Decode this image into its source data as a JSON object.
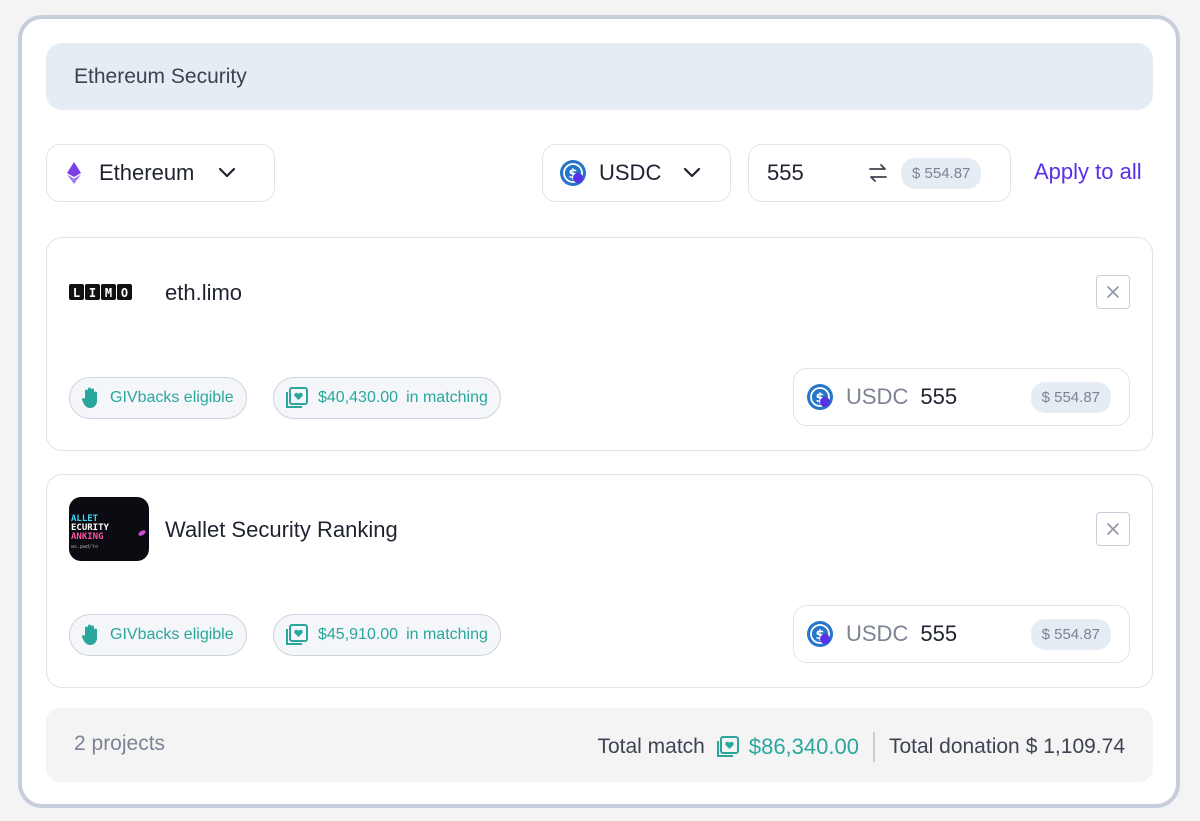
{
  "category": {
    "title": "Ethereum Security"
  },
  "network_selector": {
    "label": "Ethereum",
    "icon": "ethereum-icon"
  },
  "token_selector": {
    "label": "USDC",
    "icon": "usdc-icon"
  },
  "global_amount": {
    "value": "555",
    "usd": "$ 554.87"
  },
  "apply_all_label": "Apply to all",
  "colors": {
    "accent": "#5b2ee8",
    "teal": "#2aa79d",
    "chip_bg": "#e5ecf3"
  },
  "projects": [
    {
      "name": "eth.limo",
      "logo_text": "LIMO",
      "givbacks_label": "GIVbacks eligible",
      "matching_amount": "$40,430.00",
      "matching_suffix": "in matching",
      "token": "USDC",
      "amount": "555",
      "usd": "$ 554.87"
    },
    {
      "name": "Wallet Security Ranking",
      "logo_text": "WALLET SECURITY RANKING",
      "givbacks_label": "GIVbacks eligible",
      "matching_amount": "$45,910.00",
      "matching_suffix": "in matching",
      "token": "USDC",
      "amount": "555",
      "usd": "$ 554.87"
    }
  ],
  "footer": {
    "count": "2 projects",
    "total_match_label": "Total match",
    "total_match_value": "$86,340.00",
    "total_donation_label": "Total donation",
    "total_donation_value": "$ 1,109.74"
  }
}
